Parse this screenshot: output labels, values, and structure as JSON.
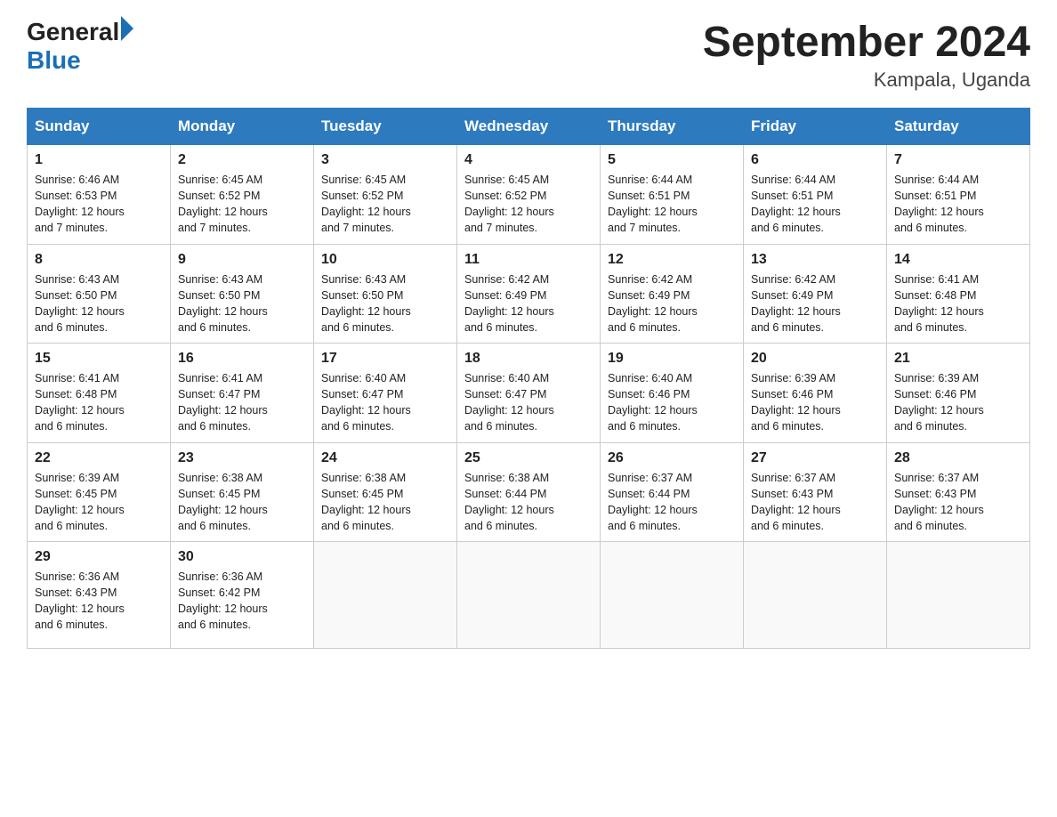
{
  "header": {
    "logo": {
      "text_general": "General",
      "text_blue": "Blue",
      "arrow_label": "logo-arrow"
    },
    "title": "September 2024",
    "subtitle": "Kampala, Uganda"
  },
  "days_of_week": [
    "Sunday",
    "Monday",
    "Tuesday",
    "Wednesday",
    "Thursday",
    "Friday",
    "Saturday"
  ],
  "weeks": [
    [
      {
        "day": "1",
        "sunrise": "6:46 AM",
        "sunset": "6:53 PM",
        "daylight": "12 hours and 7 minutes."
      },
      {
        "day": "2",
        "sunrise": "6:45 AM",
        "sunset": "6:52 PM",
        "daylight": "12 hours and 7 minutes."
      },
      {
        "day": "3",
        "sunrise": "6:45 AM",
        "sunset": "6:52 PM",
        "daylight": "12 hours and 7 minutes."
      },
      {
        "day": "4",
        "sunrise": "6:45 AM",
        "sunset": "6:52 PM",
        "daylight": "12 hours and 7 minutes."
      },
      {
        "day": "5",
        "sunrise": "6:44 AM",
        "sunset": "6:51 PM",
        "daylight": "12 hours and 7 minutes."
      },
      {
        "day": "6",
        "sunrise": "6:44 AM",
        "sunset": "6:51 PM",
        "daylight": "12 hours and 6 minutes."
      },
      {
        "day": "7",
        "sunrise": "6:44 AM",
        "sunset": "6:51 PM",
        "daylight": "12 hours and 6 minutes."
      }
    ],
    [
      {
        "day": "8",
        "sunrise": "6:43 AM",
        "sunset": "6:50 PM",
        "daylight": "12 hours and 6 minutes."
      },
      {
        "day": "9",
        "sunrise": "6:43 AM",
        "sunset": "6:50 PM",
        "daylight": "12 hours and 6 minutes."
      },
      {
        "day": "10",
        "sunrise": "6:43 AM",
        "sunset": "6:50 PM",
        "daylight": "12 hours and 6 minutes."
      },
      {
        "day": "11",
        "sunrise": "6:42 AM",
        "sunset": "6:49 PM",
        "daylight": "12 hours and 6 minutes."
      },
      {
        "day": "12",
        "sunrise": "6:42 AM",
        "sunset": "6:49 PM",
        "daylight": "12 hours and 6 minutes."
      },
      {
        "day": "13",
        "sunrise": "6:42 AM",
        "sunset": "6:49 PM",
        "daylight": "12 hours and 6 minutes."
      },
      {
        "day": "14",
        "sunrise": "6:41 AM",
        "sunset": "6:48 PM",
        "daylight": "12 hours and 6 minutes."
      }
    ],
    [
      {
        "day": "15",
        "sunrise": "6:41 AM",
        "sunset": "6:48 PM",
        "daylight": "12 hours and 6 minutes."
      },
      {
        "day": "16",
        "sunrise": "6:41 AM",
        "sunset": "6:47 PM",
        "daylight": "12 hours and 6 minutes."
      },
      {
        "day": "17",
        "sunrise": "6:40 AM",
        "sunset": "6:47 PM",
        "daylight": "12 hours and 6 minutes."
      },
      {
        "day": "18",
        "sunrise": "6:40 AM",
        "sunset": "6:47 PM",
        "daylight": "12 hours and 6 minutes."
      },
      {
        "day": "19",
        "sunrise": "6:40 AM",
        "sunset": "6:46 PM",
        "daylight": "12 hours and 6 minutes."
      },
      {
        "day": "20",
        "sunrise": "6:39 AM",
        "sunset": "6:46 PM",
        "daylight": "12 hours and 6 minutes."
      },
      {
        "day": "21",
        "sunrise": "6:39 AM",
        "sunset": "6:46 PM",
        "daylight": "12 hours and 6 minutes."
      }
    ],
    [
      {
        "day": "22",
        "sunrise": "6:39 AM",
        "sunset": "6:45 PM",
        "daylight": "12 hours and 6 minutes."
      },
      {
        "day": "23",
        "sunrise": "6:38 AM",
        "sunset": "6:45 PM",
        "daylight": "12 hours and 6 minutes."
      },
      {
        "day": "24",
        "sunrise": "6:38 AM",
        "sunset": "6:45 PM",
        "daylight": "12 hours and 6 minutes."
      },
      {
        "day": "25",
        "sunrise": "6:38 AM",
        "sunset": "6:44 PM",
        "daylight": "12 hours and 6 minutes."
      },
      {
        "day": "26",
        "sunrise": "6:37 AM",
        "sunset": "6:44 PM",
        "daylight": "12 hours and 6 minutes."
      },
      {
        "day": "27",
        "sunrise": "6:37 AM",
        "sunset": "6:43 PM",
        "daylight": "12 hours and 6 minutes."
      },
      {
        "day": "28",
        "sunrise": "6:37 AM",
        "sunset": "6:43 PM",
        "daylight": "12 hours and 6 minutes."
      }
    ],
    [
      {
        "day": "29",
        "sunrise": "6:36 AM",
        "sunset": "6:43 PM",
        "daylight": "12 hours and 6 minutes."
      },
      {
        "day": "30",
        "sunrise": "6:36 AM",
        "sunset": "6:42 PM",
        "daylight": "12 hours and 6 minutes."
      },
      null,
      null,
      null,
      null,
      null
    ]
  ],
  "labels": {
    "sunrise": "Sunrise:",
    "sunset": "Sunset:",
    "daylight": "Daylight:"
  }
}
